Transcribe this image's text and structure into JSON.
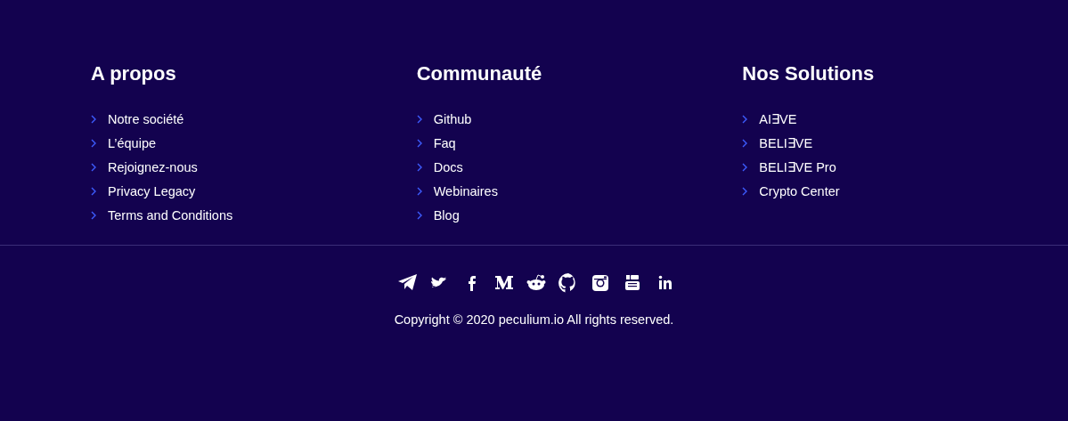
{
  "columns": [
    {
      "title": "A propos",
      "links": [
        "Notre société",
        "L’équipe",
        "Rejoignez-nous",
        "Privacy Legacy",
        "Terms and Conditions"
      ]
    },
    {
      "title": "Communauté",
      "links": [
        "Github",
        "Faq",
        "Docs",
        "Webinaires",
        "Blog"
      ]
    },
    {
      "title": "Nos Solutions",
      "links": [
        "AI∃VE",
        "BELI∃VE",
        "BELI∃VE Pro",
        "Crypto Center"
      ]
    }
  ],
  "copyright": "Copyright © 2020 peculium.io All rights reserved."
}
